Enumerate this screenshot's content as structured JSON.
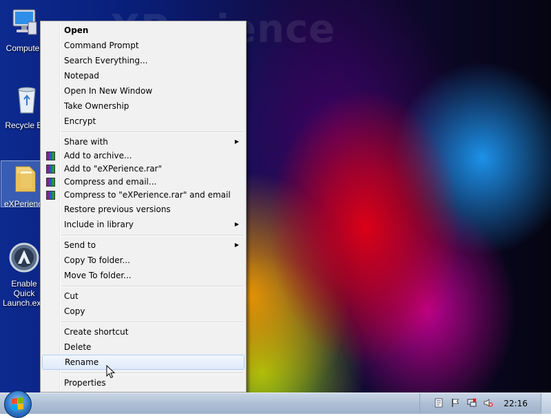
{
  "desktop": {
    "watermark": "XPerience",
    "icons": [
      {
        "label": "Computer",
        "icon": "computer-icon"
      },
      {
        "label": "Recycle Bin",
        "icon": "recycle-bin-icon"
      },
      {
        "label": "eXPerience",
        "icon": "folder-icon"
      },
      {
        "label": "Enable Quick Launch.exe",
        "icon": "quick-launch-icon"
      }
    ]
  },
  "context_menu": {
    "items": [
      {
        "label": "Open",
        "bold": true
      },
      {
        "label": "Command Prompt"
      },
      {
        "label": "Search Everything..."
      },
      {
        "label": "Notepad"
      },
      {
        "label": "Open In New Window"
      },
      {
        "label": "Take Ownership"
      },
      {
        "label": "Encrypt"
      },
      {
        "label": "Share with",
        "submenu": true
      },
      {
        "label": "Add to archive...",
        "icon": "winrar-icon"
      },
      {
        "label": "Add to \"eXPerience.rar\"",
        "icon": "winrar-icon"
      },
      {
        "label": "Compress and email...",
        "icon": "winrar-icon"
      },
      {
        "label": "Compress to \"eXPerience.rar\" and email",
        "icon": "winrar-icon"
      },
      {
        "label": "Restore previous versions"
      },
      {
        "label": "Include in library",
        "submenu": true
      },
      {
        "label": "Send to",
        "submenu": true
      },
      {
        "label": "Copy To folder..."
      },
      {
        "label": "Move To folder..."
      },
      {
        "label": "Cut"
      },
      {
        "label": "Copy"
      },
      {
        "label": "Create shortcut"
      },
      {
        "label": "Delete"
      },
      {
        "label": "Rename",
        "highlighted": true
      },
      {
        "label": "Properties"
      }
    ],
    "submenu_arrow": "▶"
  },
  "taskbar": {
    "start_icon": "windows-start-icon",
    "tray_icons": [
      "notification-icon",
      "flag-icon",
      "network-icon",
      "volume-muted-icon"
    ],
    "clock": "22:16"
  },
  "colors": {
    "menu_bg": "#f1f1f1",
    "highlight_border": "#aeccf0",
    "taskbar": "#aebfd4"
  }
}
